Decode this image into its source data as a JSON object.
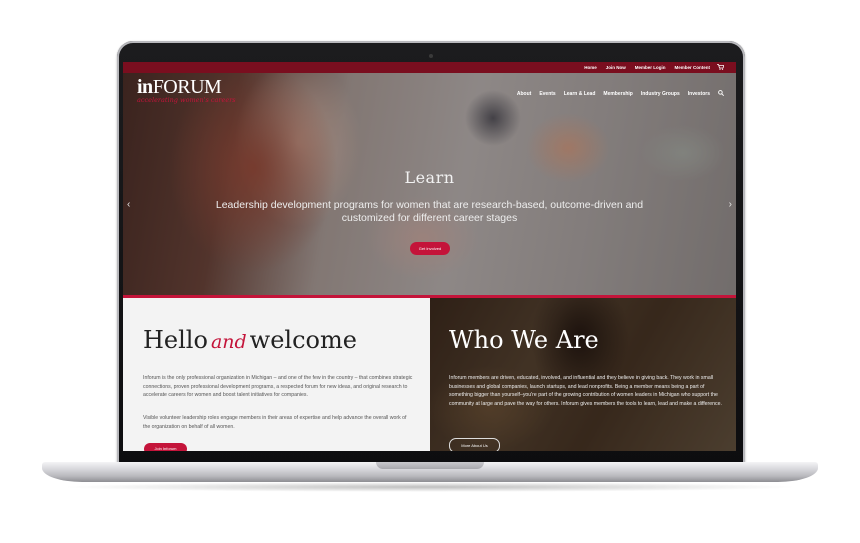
{
  "topbar": {
    "links": [
      "Home",
      "Join Now",
      "Member Login",
      "Member Content"
    ],
    "cart_icon": "cart-icon"
  },
  "logo": {
    "word_bold": "in",
    "word_rest": "FORUM",
    "tagline": "accelerating women's careers"
  },
  "nav": {
    "items": [
      "About",
      "Events",
      "Learn & Lead",
      "Membership",
      "Industry Groups",
      "Investors"
    ],
    "search_icon": "search-icon"
  },
  "hero": {
    "title": "Learn",
    "subtitle": "Leadership development programs for women that are research-based, outcome-driven and customized for different career stages",
    "button": "Get Involved",
    "prev_arrow": "‹",
    "next_arrow": "›"
  },
  "welcome": {
    "title_part1": "Hello",
    "title_and": "and",
    "title_part2": "welcome",
    "para1": "Inforum is the only professional organization in Michigan – and one of the few in the country – that combines strategic connections, proven professional development programs, a respected forum for new ideas, and original research to accelerate careers for women and boost talent initiatives for companies.",
    "para2": "Visible volunteer leadership roles engage members in their areas of expertise and help advance the overall work of the organization on behalf of all women.",
    "button": "Join Inforum"
  },
  "who": {
    "title": "Who We Are",
    "para": "Inforum members are driven, educated, involved, and influential and they believe in giving back. They work in small businesses and global companies, launch startups, and lead nonprofits. Being a member means being a part of something bigger than yourself–you're part of the growing contribution of women leaders in Michigan who support the community at large and pave the way for others. Inforum gives members the tools to learn, lead and make a difference.",
    "button": "More About Us"
  },
  "colors": {
    "brand_red": "#c4143a",
    "topbar": "#7a0e1f"
  }
}
